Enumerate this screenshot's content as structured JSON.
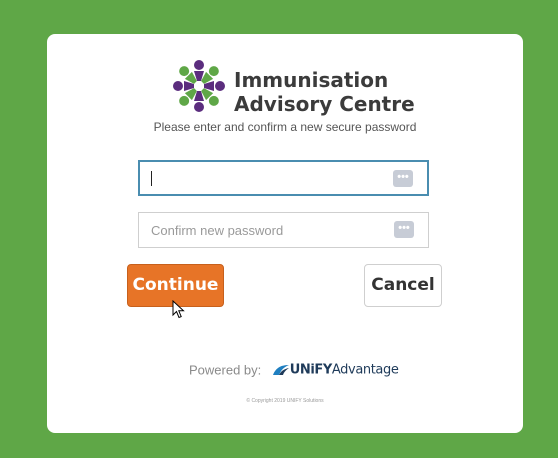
{
  "brand": {
    "line1": "Immunisation",
    "line2": "Advisory Centre",
    "colors": {
      "purple": "#5b2d7e",
      "green": "#5fa747",
      "text": "#3b3b3b"
    }
  },
  "subtitle": "Please enter and confirm a new secure password",
  "form": {
    "new_password": {
      "value": "",
      "placeholder": "",
      "icon": "password-dots-icon"
    },
    "confirm_password": {
      "value": "",
      "placeholder": "Confirm new password",
      "icon": "password-dots-icon"
    }
  },
  "buttons": {
    "continue_label": "Continue",
    "cancel_label": "Cancel",
    "continue_color": "#e77427"
  },
  "footer": {
    "powered_by": "Powered by:",
    "vendor_prefix": "UNiFY",
    "vendor_suffix": "Advantage",
    "copyright": "© Copyright 2019 UNIFY Solutions"
  },
  "page": {
    "background": "#5fa747"
  }
}
